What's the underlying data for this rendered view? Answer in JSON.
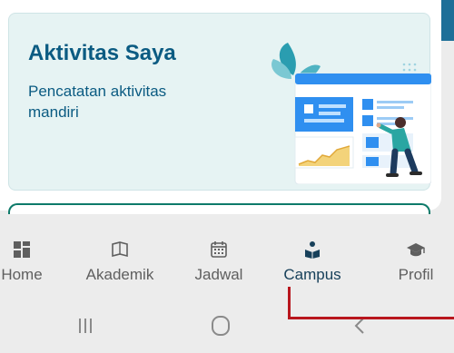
{
  "card": {
    "title": "Aktivitas Saya",
    "subtitle": "Pencatatan aktivitas mandiri"
  },
  "nav": {
    "items": [
      {
        "label": "Home",
        "icon": "grid-icon",
        "active": false
      },
      {
        "label": "Akademik",
        "icon": "book-icon",
        "active": false
      },
      {
        "label": "Jadwal",
        "icon": "calendar-icon",
        "active": false
      },
      {
        "label": "Campus",
        "icon": "campus-reader-icon",
        "active": true
      },
      {
        "label": "Profil",
        "icon": "graduation-cap-icon",
        "active": false
      }
    ]
  },
  "system_nav": {
    "buttons": [
      "recent-apps-icon",
      "home-circle-icon",
      "back-chevron-icon"
    ]
  },
  "colors": {
    "accent": "#0b5b82",
    "annotation": "#b8161d",
    "card_bg": "#e6f3f3"
  }
}
